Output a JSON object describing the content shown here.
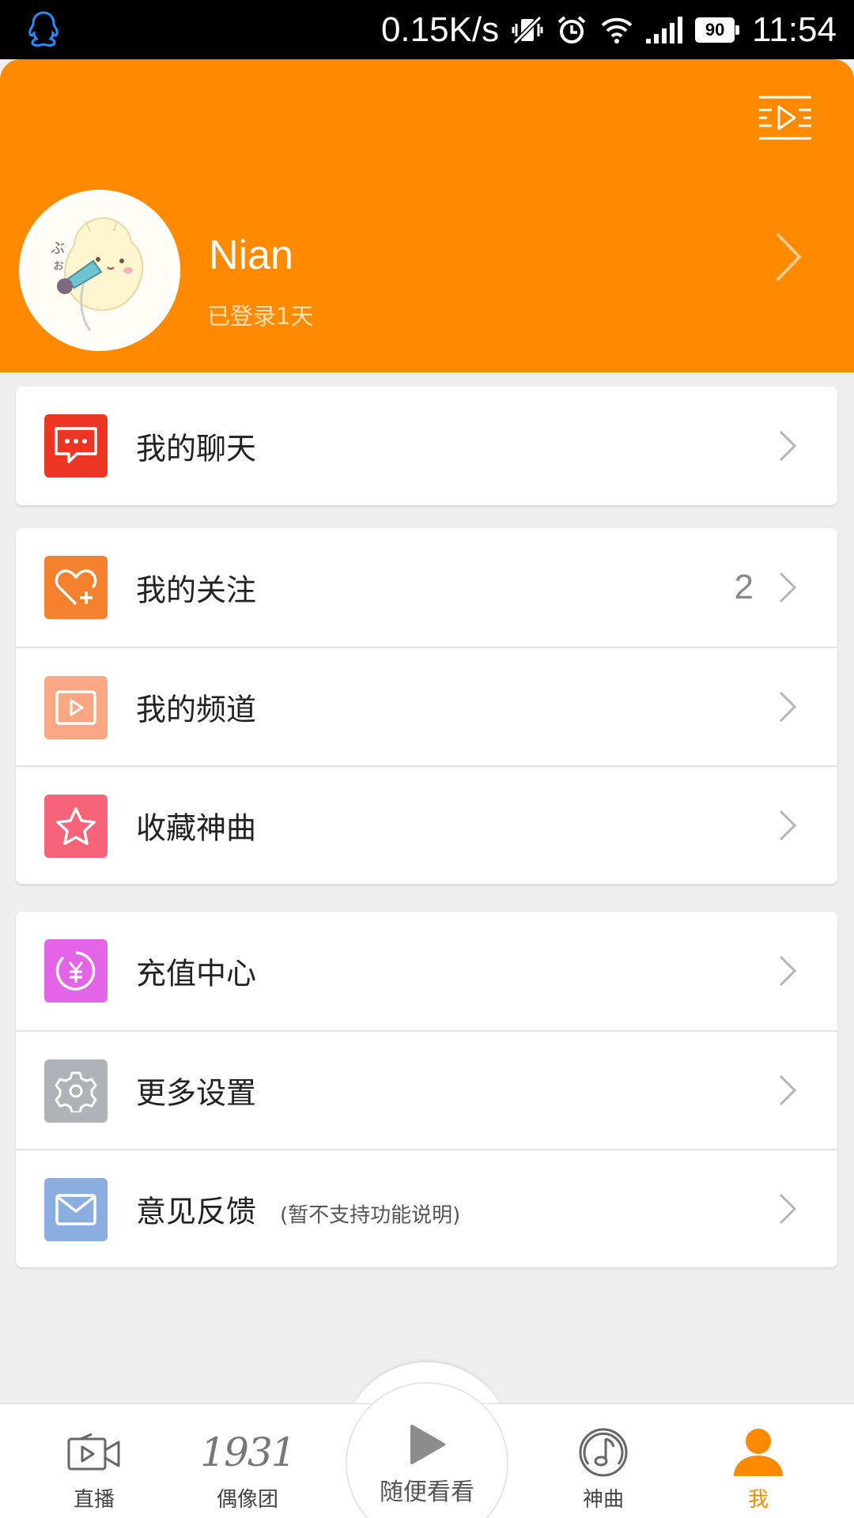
{
  "status_bar": {
    "network_speed": "0.15K/s",
    "battery": "90",
    "time": "11:54"
  },
  "header": {
    "user_name": "Nian",
    "login_days": "已登录1天"
  },
  "menu": {
    "group1": [
      {
        "label": "我的聊天",
        "icon": "chat-bubble-icon",
        "color": "#ec3523"
      }
    ],
    "group2": [
      {
        "label": "我的关注",
        "icon": "heart-plus-icon",
        "color": "#f3812e",
        "count": "2"
      },
      {
        "label": "我的频道",
        "icon": "video-play-icon",
        "color": "#fca783"
      },
      {
        "label": "收藏神曲",
        "icon": "star-icon",
        "color": "#f7647a"
      }
    ],
    "group3": [
      {
        "label": "充值中心",
        "icon": "yuan-coin-icon",
        "color": "#e464e8"
      },
      {
        "label": "更多设置",
        "icon": "gear-icon",
        "color": "#adb3b9"
      },
      {
        "label": "意见反馈",
        "icon": "mail-icon",
        "color": "#8aaee0",
        "note": "(暂不支持功能说明)"
      }
    ]
  },
  "bottom_nav": {
    "tabs": [
      {
        "label": "直播",
        "icon": "video-camera-icon"
      },
      {
        "label": "偶像团",
        "icon": "1931-logo-icon",
        "logo_text": "1931"
      },
      {
        "label": "随便看看",
        "icon": "play-icon"
      },
      {
        "label": "神曲",
        "icon": "music-note-icon"
      },
      {
        "label": "我",
        "icon": "person-icon",
        "active": true
      }
    ]
  },
  "colors": {
    "accent": "#ff8a00",
    "background": "#efeff0"
  }
}
